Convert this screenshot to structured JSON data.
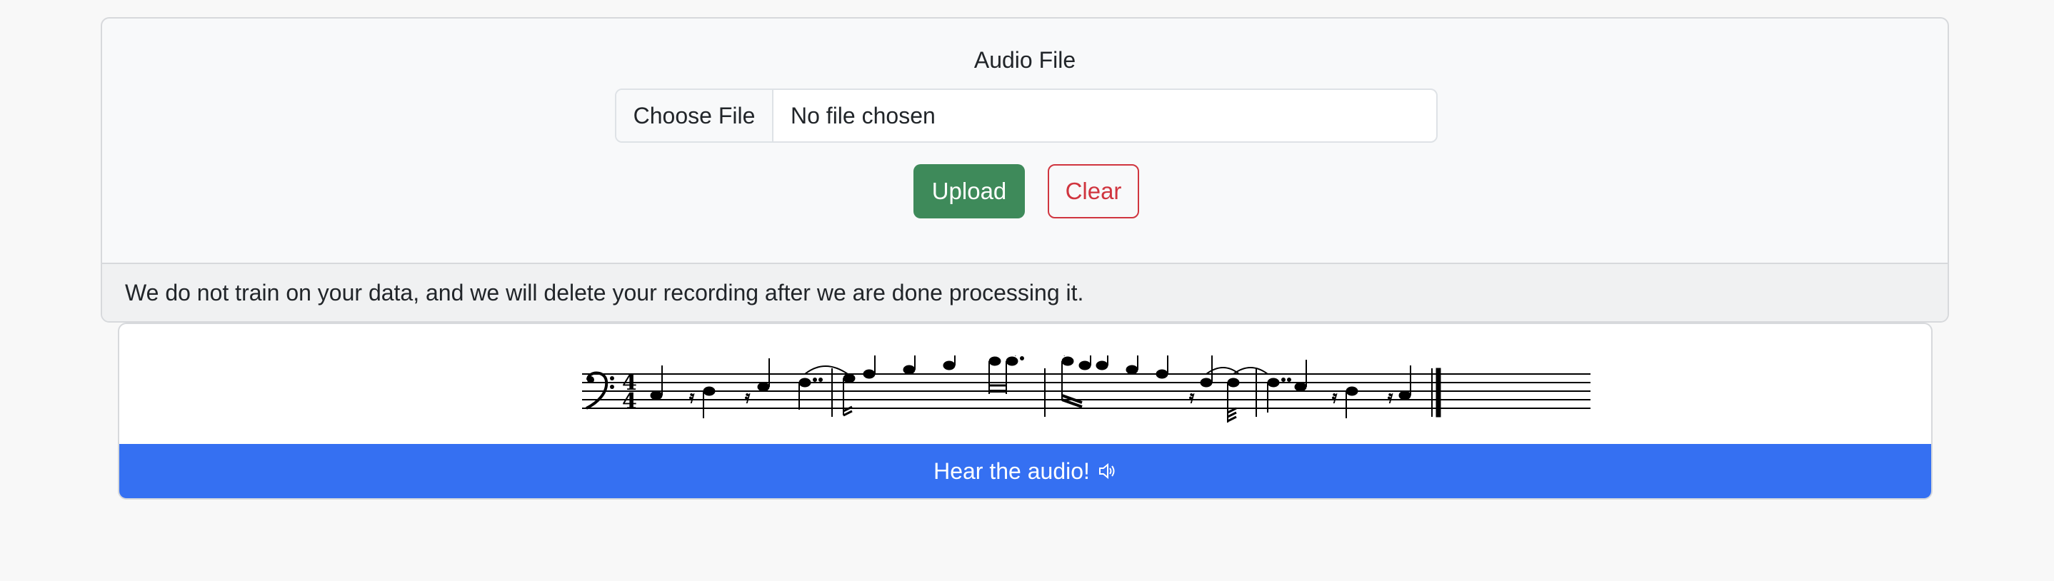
{
  "upload": {
    "label": "Audio File",
    "file_button": "Choose File",
    "file_status": "No file chosen",
    "upload_label": "Upload",
    "clear_label": "Clear",
    "privacy_note": "We do not train on your data, and we will delete your recording after we are done processing it."
  },
  "player": {
    "hear_label": "Hear the audio!",
    "speaker_icon": "speaker-icon"
  },
  "score": {
    "clef": "bass",
    "time_signature": "4/4",
    "time_top": "4",
    "time_bottom": "4"
  },
  "colors": {
    "upload_button": "#3e8a5a",
    "clear_button": "#d0353f",
    "hear_button": "#3570f2"
  }
}
